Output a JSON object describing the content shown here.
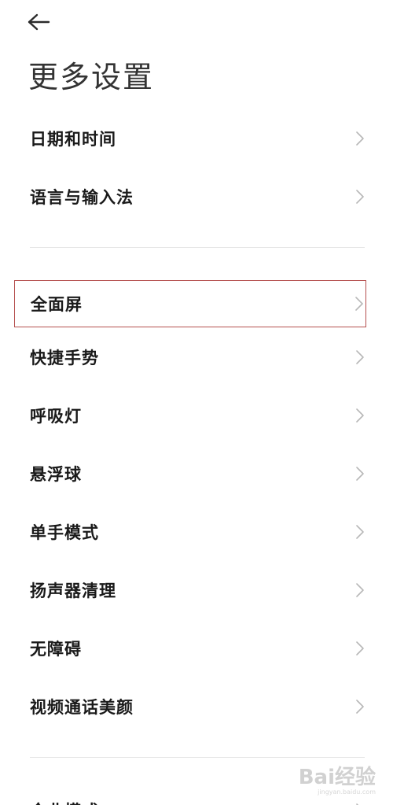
{
  "header": {
    "back_icon": "arrow-left-icon",
    "title": "更多设置"
  },
  "group1": {
    "items": [
      {
        "label": "日期和时间"
      },
      {
        "label": "语言与输入法"
      }
    ]
  },
  "group2": {
    "highlighted_index": 0,
    "highlight_color": "#b5504f",
    "items": [
      {
        "label": "全面屏"
      },
      {
        "label": "快捷手势"
      },
      {
        "label": "呼吸灯"
      },
      {
        "label": "悬浮球"
      },
      {
        "label": "单手模式"
      },
      {
        "label": "扬声器清理"
      },
      {
        "label": "无障碍"
      },
      {
        "label": "视频通话美颜"
      }
    ]
  },
  "group3": {
    "items": [
      {
        "label": "企业模式"
      }
    ]
  },
  "chevron_icon": "chevron-right-icon",
  "watermark": {
    "text": "Bai经验",
    "sub": "jingyan.baidu.com"
  }
}
